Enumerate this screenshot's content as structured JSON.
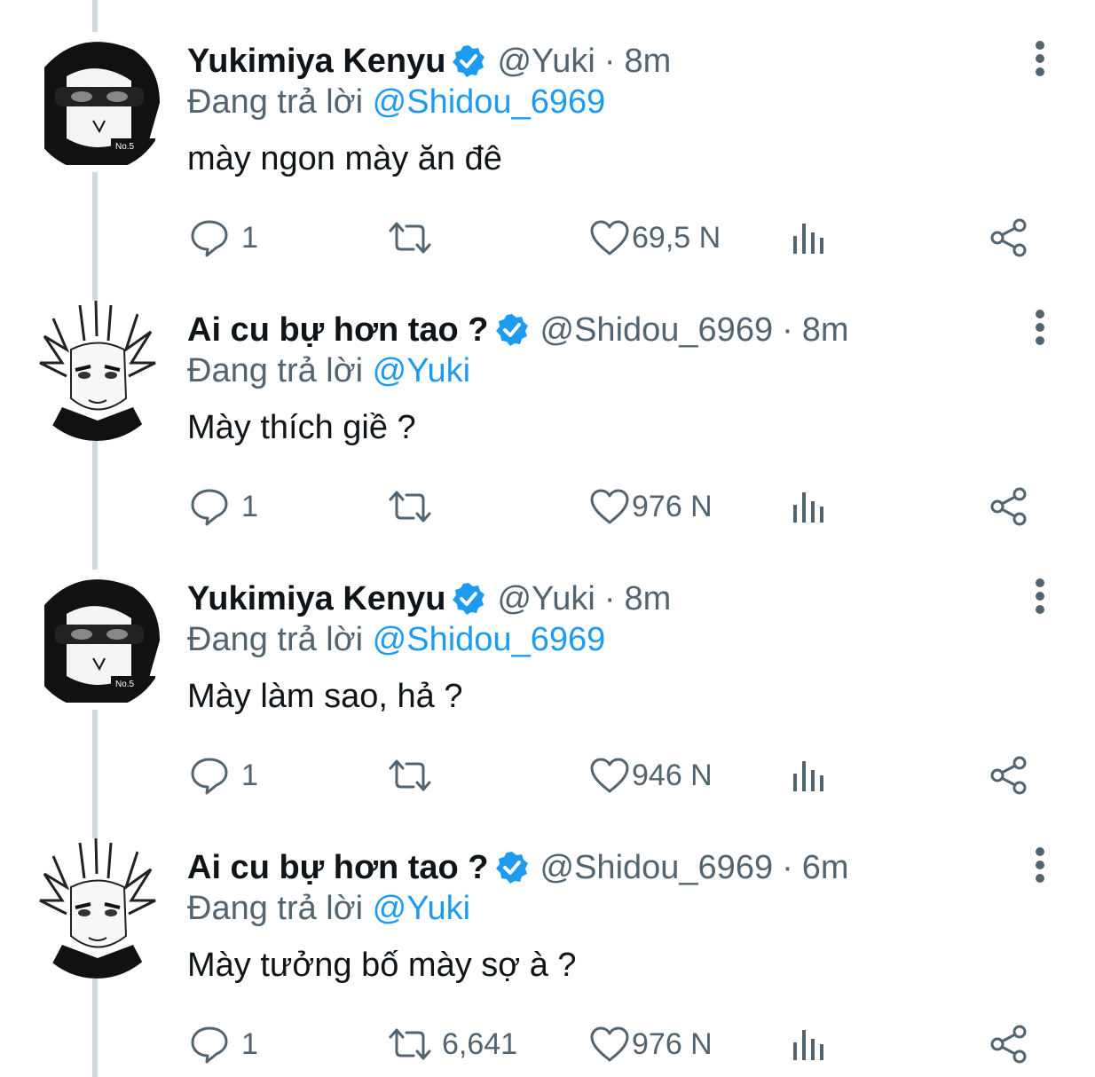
{
  "thread": [
    {
      "name": "Yukimiya Kenyu",
      "handle": "@Yuki",
      "separator": "·",
      "time": "8m",
      "reply_prefix": "Đang trả lời",
      "reply_to": "@Shidou_6969",
      "text": "mày ngon mày ăn đê",
      "replies": "1",
      "retweets": "",
      "likes": "69,5 N",
      "avatar": "yukimiya-avatar"
    },
    {
      "name": "Ai cu bự hơn tao ?",
      "handle": "@Shidou_6969",
      "separator": "·",
      "time": "8m",
      "reply_prefix": "Đang trả lời",
      "reply_to": "@Yuki",
      "text": "Mày thích giề ?",
      "replies": "1",
      "retweets": "",
      "likes": "976 N",
      "avatar": "shidou-avatar"
    },
    {
      "name": "Yukimiya Kenyu",
      "handle": "@Yuki",
      "separator": "·",
      "time": "8m",
      "reply_prefix": "Đang trả lời",
      "reply_to": "@Shidou_6969",
      "text": "Mày làm sao, hả ?",
      "replies": "1",
      "retweets": "",
      "likes": "946 N",
      "avatar": "yukimiya-avatar"
    },
    {
      "name": "Ai cu bự hơn tao ?",
      "handle": "@Shidou_6969",
      "separator": "·",
      "time": "6m",
      "reply_prefix": "Đang trả lời",
      "reply_to": "@Yuki",
      "text": "Mày tưởng bố mày sợ à ?",
      "replies": "1",
      "retweets": "6,641",
      "likes": "976 N",
      "avatar": "shidou-avatar"
    }
  ],
  "icons": {
    "verified": "verified-badge-icon",
    "more": "more-vertical-icon",
    "reply": "reply-bubble-icon",
    "retweet": "retweet-icon",
    "like": "heart-icon",
    "views": "views-bar-chart-icon",
    "share": "share-icon"
  },
  "colors": {
    "verified": "#1d9bf0",
    "link": "#1d9bf0",
    "muted": "#536471",
    "text": "#0f1419",
    "thread_line": "#cfd9de"
  }
}
